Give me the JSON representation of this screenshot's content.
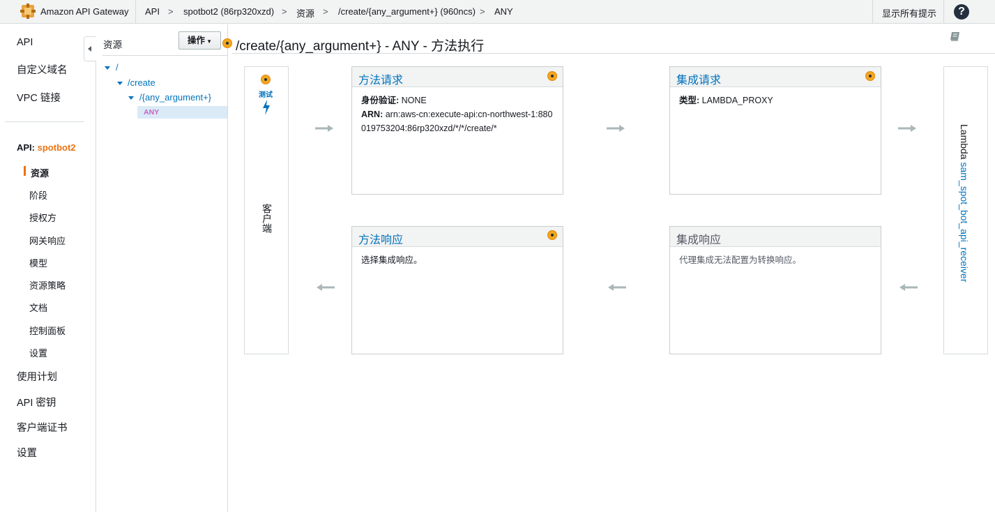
{
  "topbar": {
    "service": "Amazon API Gateway",
    "crumbs": [
      "API",
      "spotbot2 (86rp320xzd)",
      "资源",
      "/create/{any_argument+} (960ncs)",
      "ANY"
    ],
    "separator": ">",
    "show_hints": "显示所有提示",
    "help": "?"
  },
  "nav": {
    "top": [
      "API",
      "自定义域名",
      "VPC 链接"
    ],
    "api_prefix": "API:",
    "api_name": "spotbot2",
    "sub": [
      "资源",
      "阶段",
      "授权方",
      "网关响应",
      "模型",
      "资源策略",
      "文档",
      "控制面板",
      "设置"
    ],
    "bottom": [
      "使用计划",
      "API 密钥",
      "客户端证书",
      "设置"
    ]
  },
  "resources": {
    "title": "资源",
    "actions_label": "操作",
    "tree": [
      "/",
      "/create",
      "/{any_argument+}"
    ],
    "method": "ANY"
  },
  "main": {
    "title": "/create/{any_argument+} - ANY - 方法执行",
    "test_label": "测试",
    "client_label": "客户端",
    "method_request": {
      "title": "方法请求",
      "auth_label": "身份验证:",
      "auth_value": "NONE",
      "arn_label": "ARN:",
      "arn_value": "arn:aws-cn:execute-api:cn-northwest-1:880019753204:86rp320xzd/*/*/create/*"
    },
    "integration_request": {
      "title": "集成请求",
      "type_label": "类型:",
      "type_value": "LAMBDA_PROXY"
    },
    "method_response": {
      "title": "方法响应",
      "body": "选择集成响应。"
    },
    "integration_response": {
      "title": "集成响应",
      "body": "代理集成无法配置为转换响应。"
    },
    "lambda_prefix": "Lambda",
    "lambda_function": "sam_spot_bot_api_receiver"
  },
  "colors": {
    "accent_orange": "#ec7211",
    "link_blue": "#0073bb",
    "method_purple": "#c463c4"
  }
}
